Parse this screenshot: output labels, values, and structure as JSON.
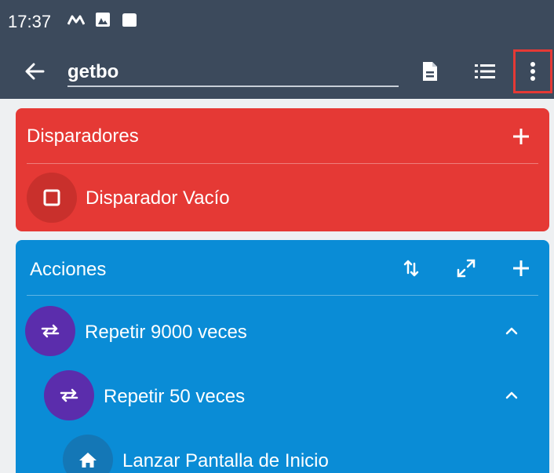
{
  "status_bar": {
    "time": "17:37",
    "icons": [
      "signal-m-icon",
      "notification-image-icon",
      "notification-card-icon"
    ]
  },
  "app_bar": {
    "back_icon": "arrow-left-icon",
    "title_value": "getbo",
    "actions": [
      "document-icon",
      "list-icon",
      "more-vert-icon"
    ]
  },
  "triggers": {
    "title": "Disparadores",
    "color": "#e53935",
    "add_icon": "plus-icon",
    "items": [
      {
        "label": "Disparador Vacío",
        "icon": "square-outline-icon"
      }
    ]
  },
  "actions": {
    "title": "Acciones",
    "color": "#0a8cd6",
    "header_icons": [
      "sort-arrows-icon",
      "expand-icon",
      "plus-icon"
    ],
    "items": [
      {
        "label": "Repetir 9000 veces",
        "icon": "repeat-icon",
        "color": "#5b2dac",
        "level": 0,
        "expanded": true
      },
      {
        "label": "Repetir 50 veces",
        "icon": "repeat-icon",
        "color": "#5b2dac",
        "level": 1,
        "expanded": true
      },
      {
        "label": "Lanzar Pantalla de Inicio",
        "icon": "home-icon",
        "color": "#1477b6",
        "level": 2
      }
    ]
  }
}
